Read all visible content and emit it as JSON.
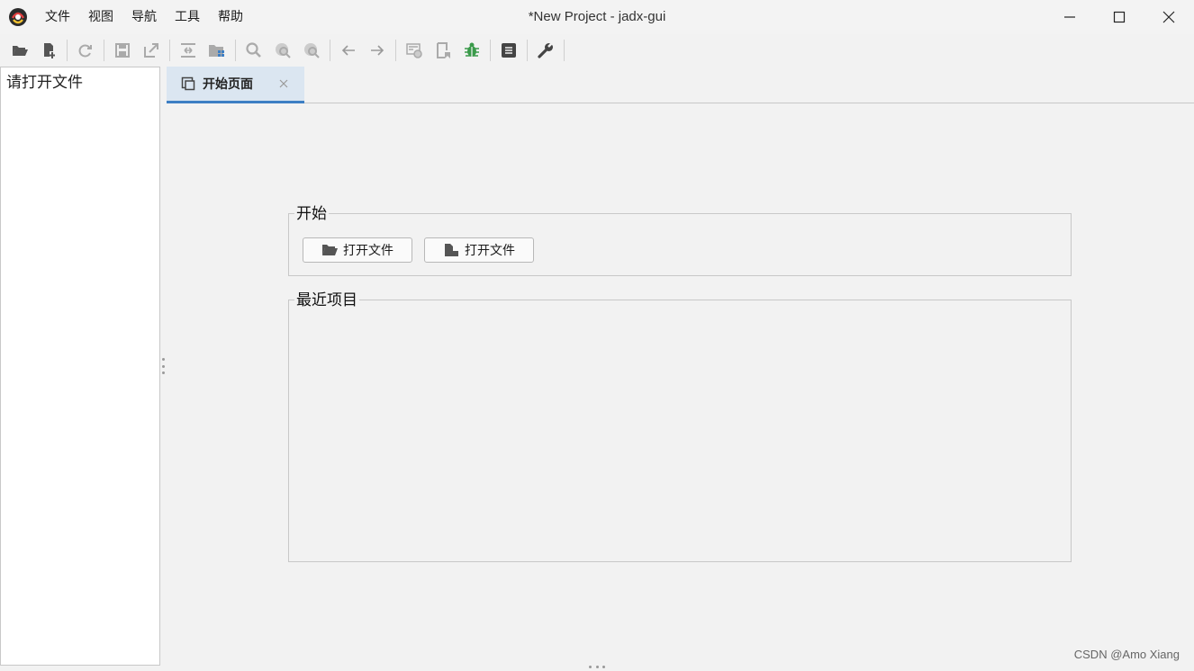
{
  "window": {
    "title": "*New Project - jadx-gui",
    "buttons": [
      "minimize",
      "maximize",
      "close"
    ]
  },
  "menu": {
    "items": [
      "文件",
      "视图",
      "导航",
      "工具",
      "帮助"
    ]
  },
  "toolbar": {
    "icons": [
      "open-file-icon",
      "add-file-icon",
      "reload-icon",
      "save-icon",
      "export-icon",
      "sync-icon",
      "flatten-packages-icon",
      "search-icon",
      "search-class-icon",
      "search-usage-icon",
      "back-icon",
      "forward-icon",
      "decompile-all-icon",
      "bookmark-icon",
      "debug-icon",
      "log-icon",
      "preferences-icon"
    ],
    "debug_color": "#3a9a4a"
  },
  "tree": {
    "placeholder": "请打开文件"
  },
  "tabs": [
    {
      "label": "开始页面"
    }
  ],
  "start_section": {
    "title": "开始",
    "buttons": [
      {
        "label": "打开文件",
        "icon": "folder-open-icon"
      },
      {
        "label": "打开文件",
        "icon": "add-file-icon"
      }
    ]
  },
  "recent_section": {
    "title": "最近项目",
    "items": []
  },
  "watermark": "CSDN @Amo Xiang",
  "colors": {
    "accent": "#3d7fc4",
    "tab_active_bg": "#dbe6f1"
  }
}
